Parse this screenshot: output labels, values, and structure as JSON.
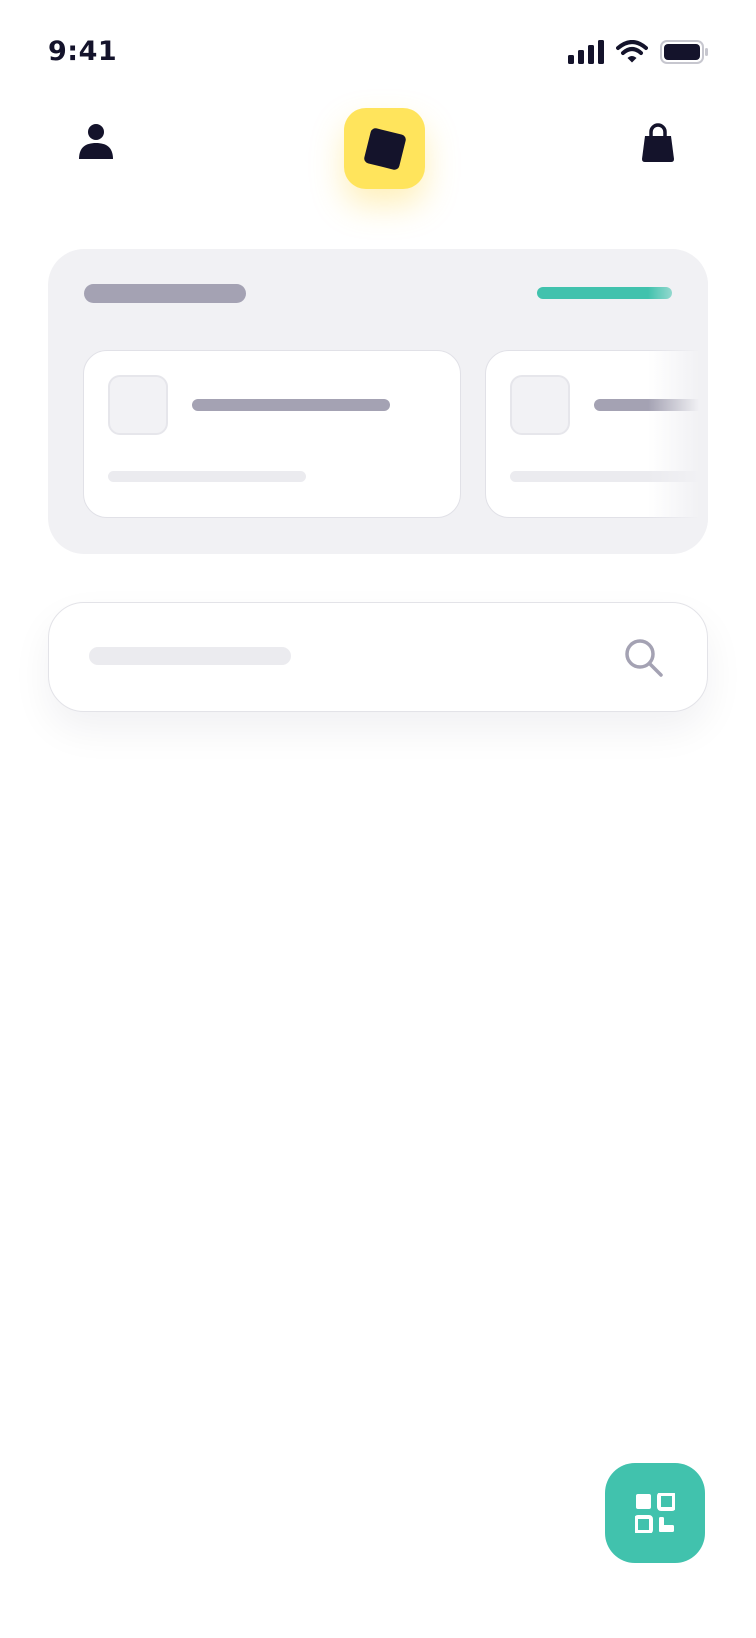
{
  "status_bar": {
    "time": "9:41",
    "icons": [
      "signal-icon",
      "wifi-icon",
      "battery-icon"
    ]
  },
  "header": {
    "left_icon": "user-icon",
    "logo": "app-logo-icon",
    "right_icon": "shopping-bag-icon"
  },
  "search": {
    "icon": "search-icon"
  },
  "fab": {
    "icon": "qr-code-icon"
  },
  "colors": {
    "ink": "#14132b",
    "brand_yellow": "#ffe45c",
    "accent_teal": "#41c2ad",
    "card_bg": "#f1f1f4",
    "skeleton_dark": "#a4a2b3",
    "skeleton_light": "#ebebef"
  }
}
